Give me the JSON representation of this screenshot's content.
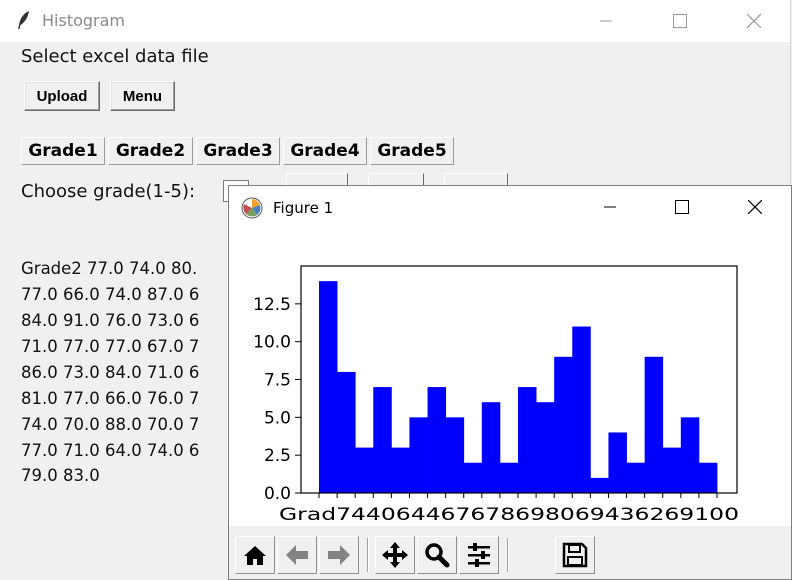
{
  "window": {
    "title": "Histogram"
  },
  "main": {
    "prompt": "Select excel data file",
    "upload_label": "Upload",
    "menu_label": "Menu",
    "grade_tabs": [
      "Grade1",
      "Grade2",
      "Grade3",
      "Grade4",
      "Grade5"
    ],
    "choose_label": "Choose grade(1-5):",
    "data_lines": [
      "Grade2 77.0 74.0 80.",
      "77.0 66.0 74.0 87.0 6",
      "84.0 91.0 76.0 73.0 6",
      "71.0 77.0 77.0 67.0 7",
      "86.0 73.0 84.0 71.0 6",
      "81.0 77.0 66.0 76.0 7",
      "74.0 70.0 88.0 70.0 7",
      "77.0 71.0 64.0 74.0 6",
      "79.0 83.0"
    ]
  },
  "figure": {
    "title": "Figure 1",
    "chart_data": {
      "type": "bar",
      "title": "",
      "xlabel": "",
      "ylabel": "",
      "ylim": [
        0,
        15
      ],
      "yticks": [
        "0.0",
        "2.5",
        "5.0",
        "7.5",
        "10.0",
        "12.5"
      ],
      "x_tick_text": "Grad744064467678698069436269100",
      "bar_color": "#0000ff",
      "values": [
        14,
        8,
        3,
        7,
        3,
        5,
        7,
        5,
        2,
        6,
        2,
        7,
        6,
        9,
        11,
        1,
        4,
        2,
        9,
        3,
        5,
        2
      ]
    },
    "toolbar": [
      "home-icon",
      "back-arrow-icon",
      "forward-arrow-icon",
      "pan-icon",
      "zoom-icon",
      "configure-subplots-icon",
      "save-icon"
    ]
  }
}
